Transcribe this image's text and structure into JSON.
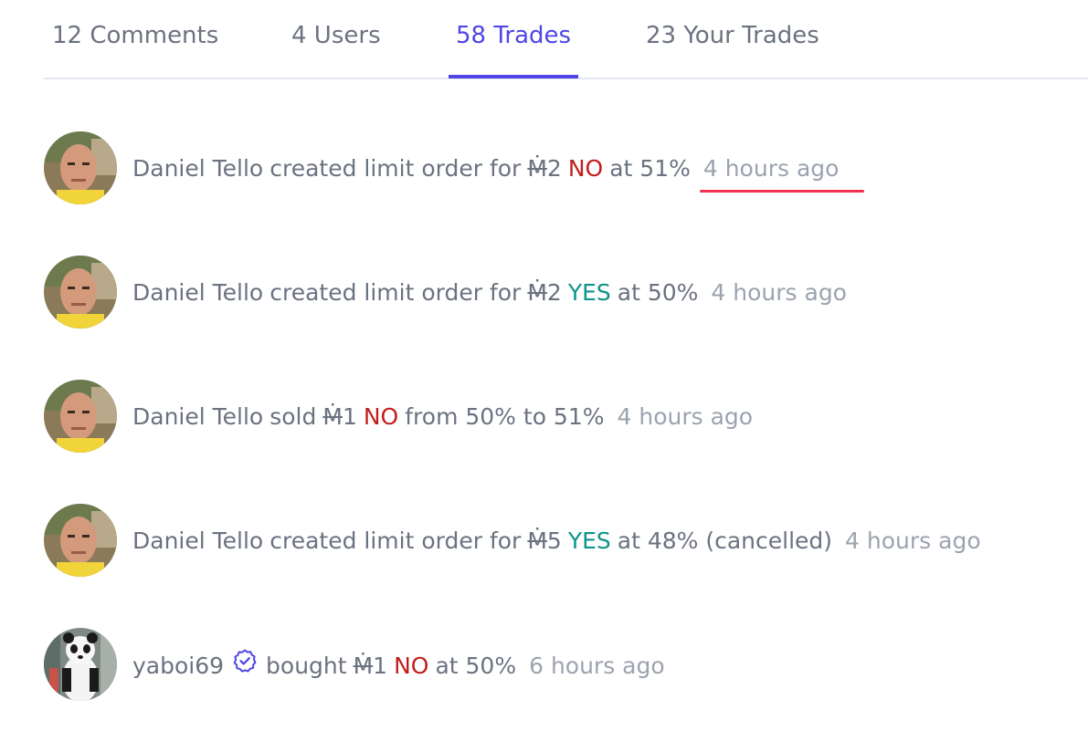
{
  "tabs": [
    {
      "label": "12 Comments",
      "active": false
    },
    {
      "label": "4 Users",
      "active": false
    },
    {
      "label": "58 Trades",
      "active": true
    },
    {
      "label": "23 Your Trades",
      "active": false
    }
  ],
  "colors": {
    "accent": "#4f46e5",
    "no": "#c21e1e",
    "yes": "#0d9488",
    "muted_text": "#6b7280",
    "time_text": "#9ca3af",
    "highlight_underline": "#ef3250"
  },
  "trades": [
    {
      "user": "Daniel Tello",
      "action": "created limit order for",
      "mana_symbol": "Ṁ",
      "amount": "2",
      "outcome": "NO",
      "tail": "at 51%",
      "time": "4 hours ago"
    },
    {
      "user": "Daniel Tello",
      "action": "created limit order for",
      "mana_symbol": "Ṁ",
      "amount": "2",
      "outcome": "YES",
      "tail": "at 50%",
      "time": "4 hours ago"
    },
    {
      "user": "Daniel Tello",
      "action": "sold",
      "mana_symbol": "Ṁ",
      "amount": "1",
      "outcome": "NO",
      "tail": "from 50% to 51%",
      "time": "4 hours ago"
    },
    {
      "user": "Daniel Tello",
      "action": "created limit order for",
      "mana_symbol": "Ṁ",
      "amount": "5",
      "outcome": "YES",
      "tail": "at 48% (cancelled)",
      "time": "4 hours ago"
    },
    {
      "user": "yaboi69",
      "action": "bought",
      "mana_symbol": "Ṁ",
      "amount": "1",
      "outcome": "NO",
      "tail": "at 50%",
      "time": "6 hours ago",
      "verified_icon": "verified-badge-icon"
    }
  ]
}
